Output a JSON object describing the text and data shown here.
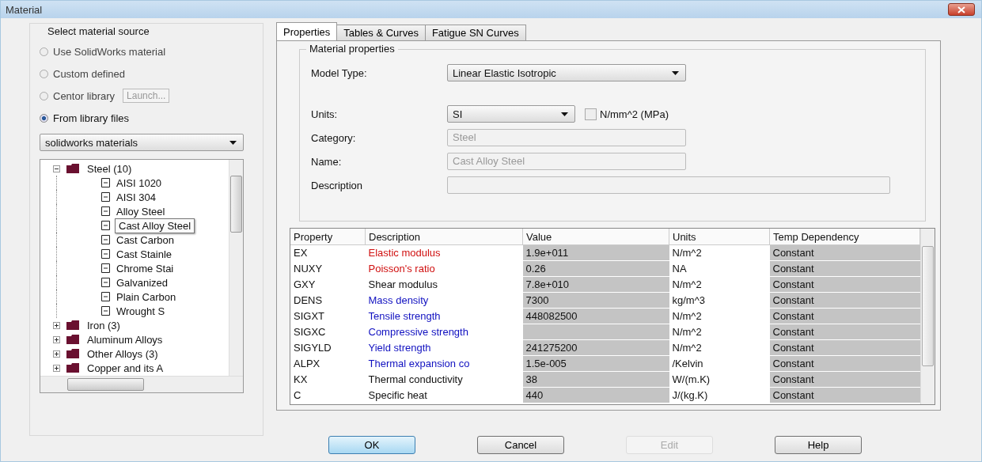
{
  "window": {
    "title": "Material"
  },
  "source": {
    "title": "Select material source",
    "options": [
      {
        "label": "Use SolidWorks material",
        "selected": false
      },
      {
        "label": "Custom defined",
        "selected": false
      },
      {
        "label": "Centor library",
        "selected": false,
        "button": "Launch..."
      },
      {
        "label": "From library files",
        "selected": true
      }
    ],
    "library": "solidworks materials"
  },
  "tree": [
    {
      "label": "Steel (10)",
      "kind": "category",
      "expanded": true,
      "children": [
        {
          "label": "AISI 1020",
          "kind": "material",
          "selected": false
        },
        {
          "label": "AISI 304",
          "kind": "material",
          "selected": false
        },
        {
          "label": "Alloy Steel",
          "kind": "material",
          "selected": false
        },
        {
          "label": "Cast Alloy Steel",
          "kind": "material",
          "selected": true
        },
        {
          "label": "Cast Carbon",
          "kind": "material",
          "selected": false
        },
        {
          "label": "Cast Stainle",
          "kind": "material",
          "selected": false
        },
        {
          "label": "Chrome Stai",
          "kind": "material",
          "selected": false
        },
        {
          "label": "Galvanized",
          "kind": "material",
          "selected": false
        },
        {
          "label": "Plain Carbon",
          "kind": "material",
          "selected": false
        },
        {
          "label": "Wrought S",
          "kind": "material",
          "selected": false
        }
      ]
    },
    {
      "label": "Iron (3)",
      "kind": "category",
      "expanded": false,
      "selected": false
    },
    {
      "label": "Aluminum Alloys",
      "kind": "category",
      "expanded": false,
      "selected": false
    },
    {
      "label": "Other Alloys (3)",
      "kind": "category",
      "expanded": false,
      "selected": false
    },
    {
      "label": "Copper and its A",
      "kind": "category",
      "expanded": false,
      "selected": false
    }
  ],
  "tabs": [
    {
      "label": "Properties",
      "selected": true
    },
    {
      "label": "Tables & Curves",
      "selected": false
    },
    {
      "label": "Fatigue SN Curves",
      "selected": false
    }
  ],
  "properties": {
    "title": "Material properties",
    "model_type_label": "Model Type:",
    "model_type": "Linear Elastic Isotropic",
    "units_label": "Units:",
    "units": "SI",
    "mpa_label": "N/mm^2 (MPa)",
    "mpa_checked": false,
    "category_label": "Category:",
    "category": "Steel",
    "name_label": "Name:",
    "name": "Cast Alloy Steel",
    "description_label": "Description"
  },
  "table": {
    "columns": [
      "Property",
      "Description",
      "Value",
      "Units",
      "Temp Dependency"
    ],
    "rows": [
      {
        "property": "EX",
        "description": "Elastic modulus",
        "color": "#d01010",
        "value": "1.9e+011",
        "units": "N/m^2",
        "temp": "Constant"
      },
      {
        "property": "NUXY",
        "description": "Poisson's ratio",
        "color": "#d01010",
        "value": "0.26",
        "units": "NA",
        "temp": "Constant"
      },
      {
        "property": "GXY",
        "description": "Shear modulus",
        "color": "#101010",
        "value": "7.8e+010",
        "units": "N/m^2",
        "temp": "Constant"
      },
      {
        "property": "DENS",
        "description": "Mass density",
        "color": "#1010c0",
        "value": "7300",
        "units": "kg/m^3",
        "temp": "Constant"
      },
      {
        "property": "SIGXT",
        "description": "Tensile strength",
        "color": "#1010c0",
        "value": "448082500",
        "units": "N/m^2",
        "temp": "Constant"
      },
      {
        "property": "SIGXC",
        "description": "Compressive strength",
        "color": "#1010c0",
        "units": "N/m^2",
        "temp": "Constant"
      },
      {
        "property": "SIGYLD",
        "description": "Yield strength",
        "color": "#1010c0",
        "value": "241275200",
        "units": "N/m^2",
        "temp": "Constant"
      },
      {
        "property": "ALPX",
        "description": "Thermal expansion co",
        "color": "#1010c0",
        "value": "1.5e-005",
        "units": "/Kelvin",
        "temp": "Constant"
      },
      {
        "property": "KX",
        "description": "Thermal conductivity",
        "color": "#101010",
        "value": "38",
        "units": "W/(m.K)",
        "temp": "Constant"
      },
      {
        "property": "C",
        "description": "Specific heat",
        "color": "#101010",
        "value": "440",
        "units": "J/(kg.K)",
        "temp": "Constant"
      }
    ]
  },
  "buttons": [
    {
      "label": "OK",
      "default": true,
      "disabled": false
    },
    {
      "label": "Cancel",
      "default": false,
      "disabled": false
    },
    {
      "label": "Edit",
      "default": false,
      "disabled": true
    },
    {
      "label": "Help",
      "default": false,
      "disabled": false
    }
  ]
}
